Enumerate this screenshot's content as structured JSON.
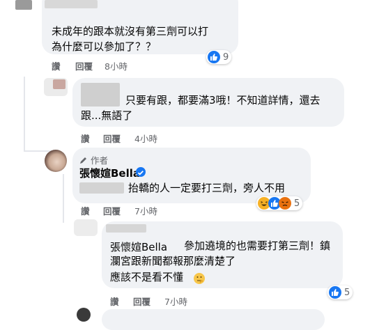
{
  "comments": [
    {
      "text_lines": [
        "未成年的跟本就沒有第三劑可以打",
        "為什麼可以參加了？？"
      ],
      "actions": {
        "like": "讚",
        "reply": "回覆",
        "time": "8小時"
      },
      "reactions": {
        "icons": [
          "like-icon"
        ],
        "count": "9"
      }
    },
    {
      "text_lines": [
        "只要有跟，都要滿3哦！不知道詳情，還去",
        "跟...無語了"
      ],
      "actions": {
        "like": "讚",
        "reply": "回覆",
        "time": "4小時"
      }
    },
    {
      "author_badge": "作者",
      "author_name": "張懷媗Bella",
      "text_lines": [
        "抬轎的人一定要打三劑，旁人不用"
      ],
      "actions": {
        "like": "讚",
        "reply": "回覆",
        "time": "7小時"
      },
      "reactions": {
        "icons": [
          "haha-icon",
          "like-icon",
          "angry-icon"
        ],
        "count": "5"
      }
    },
    {
      "mention": "張懷媗Bella",
      "text_lines": [
        "參加遶境的也需要打第三劑！鎮",
        "瀾宮跟新聞都報那麼清楚了",
        "應該不是看不懂"
      ],
      "actions": {
        "like": "讚",
        "reply": "回覆",
        "time": "7小時"
      },
      "reactions": {
        "icons": [
          "like-icon"
        ],
        "count": "5"
      }
    }
  ],
  "colors": {
    "bubble": "#f0f2f5",
    "secondary_text": "#65676b",
    "like_blue": "#1877f2",
    "verified_blue": "#1877f2"
  }
}
